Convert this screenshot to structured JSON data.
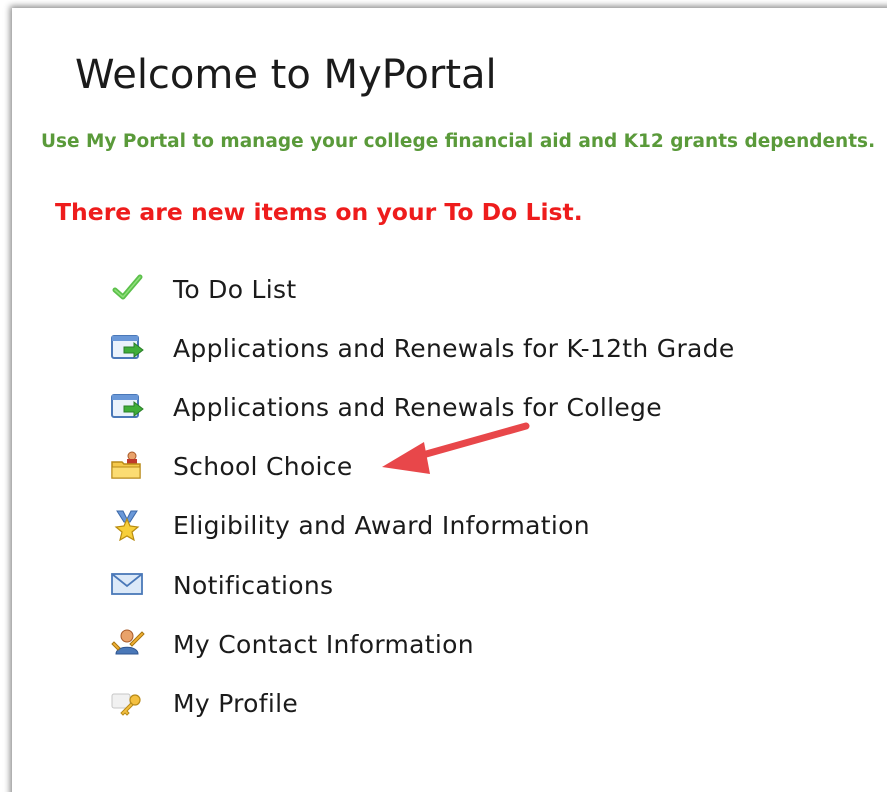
{
  "header": {
    "title": "Welcome to MyPortal",
    "intro": "Use My Portal to manage your college financial aid and K12 grants dependents.",
    "alert": "There are new items on your To Do List."
  },
  "menu": {
    "items": [
      {
        "label": "To Do List",
        "icon": "checkmark-icon"
      },
      {
        "label": "Applications and Renewals for K-12th Grade",
        "icon": "window-arrow-icon"
      },
      {
        "label": "Applications and Renewals for College",
        "icon": "window-arrow-icon"
      },
      {
        "label": "School Choice",
        "icon": "school-folder-icon"
      },
      {
        "label": "Eligibility and Award Information",
        "icon": "star-icon"
      },
      {
        "label": "Notifications",
        "icon": "envelope-icon"
      },
      {
        "label": "My Contact Information",
        "icon": "contact-person-icon"
      },
      {
        "label": "My Profile",
        "icon": "key-icon"
      }
    ]
  },
  "colors": {
    "intro_text": "#5a9a3a",
    "alert_text": "#ee1c1c",
    "annotation_arrow": "#e8474a"
  }
}
